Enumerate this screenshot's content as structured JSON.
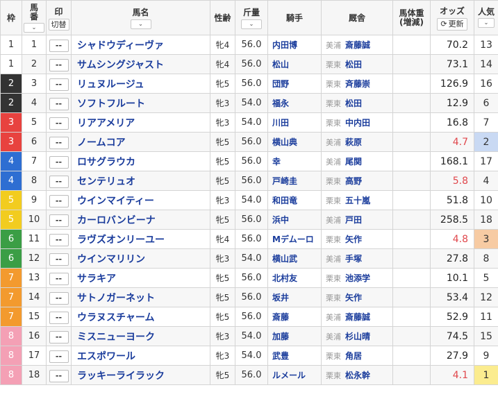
{
  "header": {
    "waku": "枠",
    "umaban": [
      "馬",
      "番"
    ],
    "mark": "印",
    "mark_toggle": "切替",
    "name": "馬名",
    "sexage": "性齢",
    "weight": "斤量",
    "jockey": "騎手",
    "stable": "厩舎",
    "body_weight": [
      "馬体重",
      "(増減)"
    ],
    "odds": "オッズ",
    "update": "更新",
    "popularity": [
      "人",
      "気"
    ]
  },
  "colors": {
    "waku": {
      "1": "#ffffff",
      "2": "#333333",
      "3": "#e8423f",
      "4": "#2e6ed2",
      "5": "#f2cc1f",
      "6": "#3b9e45",
      "7": "#f39a2e",
      "8": "#f4a0b5"
    },
    "link": "#1a3c9c",
    "hot_odds": "#e0474c"
  },
  "horses": [
    {
      "waku": "1",
      "num": "1",
      "mark": "--",
      "name": "シャドウディーヴァ",
      "sexage": "牝4",
      "weight": "56.0",
      "jockey": "内田博",
      "aff": "美浦",
      "trainer": "斎藤誠",
      "bw": "",
      "odds": "70.2",
      "pop": "13"
    },
    {
      "waku": "1",
      "num": "2",
      "mark": "--",
      "name": "サムシングジャスト",
      "sexage": "牝4",
      "weight": "56.0",
      "jockey": "松山",
      "aff": "栗東",
      "trainer": "松田",
      "bw": "",
      "odds": "73.1",
      "pop": "14"
    },
    {
      "waku": "2",
      "num": "3",
      "mark": "--",
      "name": "リュヌルージュ",
      "sexage": "牝5",
      "weight": "56.0",
      "jockey": "団野",
      "aff": "栗東",
      "trainer": "斉藤崇",
      "bw": "",
      "odds": "126.9",
      "pop": "16"
    },
    {
      "waku": "2",
      "num": "4",
      "mark": "--",
      "name": "ソフトフルート",
      "sexage": "牝3",
      "weight": "54.0",
      "jockey": "福永",
      "aff": "栗東",
      "trainer": "松田",
      "bw": "",
      "odds": "12.9",
      "pop": "6"
    },
    {
      "waku": "3",
      "num": "5",
      "mark": "--",
      "name": "リアアメリア",
      "sexage": "牝3",
      "weight": "54.0",
      "jockey": "川田",
      "aff": "栗東",
      "trainer": "中内田",
      "bw": "",
      "odds": "16.8",
      "pop": "7"
    },
    {
      "waku": "3",
      "num": "6",
      "mark": "--",
      "name": "ノームコア",
      "sexage": "牝5",
      "weight": "56.0",
      "jockey": "横山典",
      "aff": "美浦",
      "trainer": "萩原",
      "bw": "",
      "odds": "4.7",
      "pop": "2"
    },
    {
      "waku": "4",
      "num": "7",
      "mark": "--",
      "name": "ロサグラウカ",
      "sexage": "牝5",
      "weight": "56.0",
      "jockey": "幸",
      "aff": "美浦",
      "trainer": "尾関",
      "bw": "",
      "odds": "168.1",
      "pop": "17"
    },
    {
      "waku": "4",
      "num": "8",
      "mark": "--",
      "name": "センテリュオ",
      "sexage": "牝5",
      "weight": "56.0",
      "jockey": "戸崎圭",
      "aff": "栗東",
      "trainer": "高野",
      "bw": "",
      "odds": "5.8",
      "pop": "4"
    },
    {
      "waku": "5",
      "num": "9",
      "mark": "--",
      "name": "ウインマイティー",
      "sexage": "牝3",
      "weight": "54.0",
      "jockey": "和田竜",
      "aff": "栗東",
      "trainer": "五十嵐",
      "bw": "",
      "odds": "51.8",
      "pop": "10"
    },
    {
      "waku": "5",
      "num": "10",
      "mark": "--",
      "name": "カーロバンビーナ",
      "sexage": "牝5",
      "weight": "56.0",
      "jockey": "浜中",
      "aff": "美浦",
      "trainer": "戸田",
      "bw": "",
      "odds": "258.5",
      "pop": "18"
    },
    {
      "waku": "6",
      "num": "11",
      "mark": "--",
      "name": "ラヴズオンリーユー",
      "sexage": "牝4",
      "weight": "56.0",
      "jockey": "Mデムーロ",
      "aff": "栗東",
      "trainer": "矢作",
      "bw": "",
      "odds": "4.8",
      "pop": "3"
    },
    {
      "waku": "6",
      "num": "12",
      "mark": "--",
      "name": "ウインマリリン",
      "sexage": "牝3",
      "weight": "54.0",
      "jockey": "横山武",
      "aff": "美浦",
      "trainer": "手塚",
      "bw": "",
      "odds": "27.8",
      "pop": "8"
    },
    {
      "waku": "7",
      "num": "13",
      "mark": "--",
      "name": "サラキア",
      "sexage": "牝5",
      "weight": "56.0",
      "jockey": "北村友",
      "aff": "栗東",
      "trainer": "池添学",
      "bw": "",
      "odds": "10.1",
      "pop": "5"
    },
    {
      "waku": "7",
      "num": "14",
      "mark": "--",
      "name": "サトノガーネット",
      "sexage": "牝5",
      "weight": "56.0",
      "jockey": "坂井",
      "aff": "栗東",
      "trainer": "矢作",
      "bw": "",
      "odds": "53.4",
      "pop": "12"
    },
    {
      "waku": "7",
      "num": "15",
      "mark": "--",
      "name": "ウラヌスチャーム",
      "sexage": "牝5",
      "weight": "56.0",
      "jockey": "斎藤",
      "aff": "美浦",
      "trainer": "斎藤誠",
      "bw": "",
      "odds": "52.9",
      "pop": "11"
    },
    {
      "waku": "8",
      "num": "16",
      "mark": "--",
      "name": "ミスニューヨーク",
      "sexage": "牝3",
      "weight": "54.0",
      "jockey": "加藤",
      "aff": "美浦",
      "trainer": "杉山晴",
      "bw": "",
      "odds": "74.5",
      "pop": "15"
    },
    {
      "waku": "8",
      "num": "17",
      "mark": "--",
      "name": "エスポワール",
      "sexage": "牝3",
      "weight": "54.0",
      "jockey": "武豊",
      "aff": "栗東",
      "trainer": "角居",
      "bw": "",
      "odds": "27.9",
      "pop": "9"
    },
    {
      "waku": "8",
      "num": "18",
      "mark": "--",
      "name": "ラッキーライラック",
      "sexage": "牝5",
      "weight": "56.0",
      "jockey": "ルメール",
      "aff": "栗東",
      "trainer": "松永幹",
      "bw": "",
      "odds": "4.1",
      "pop": "1"
    }
  ]
}
